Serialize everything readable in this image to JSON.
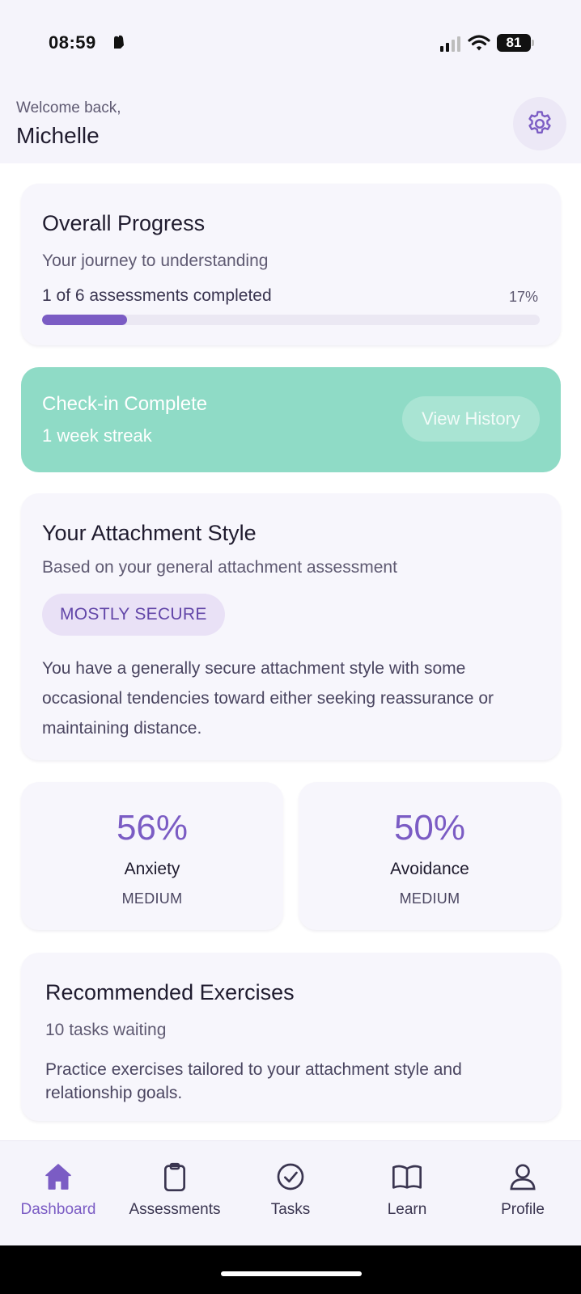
{
  "status_bar": {
    "time": "08:59",
    "battery": "81"
  },
  "header": {
    "welcome": "Welcome back,",
    "user_name": "Michelle"
  },
  "progress": {
    "title": "Overall Progress",
    "subtitle": "Your journey to understanding",
    "summary": "1 of 6 assessments completed",
    "percent_label": "17%",
    "fraction": 0.17
  },
  "checkin": {
    "title": "Check-in Complete",
    "streak": "1 week streak",
    "history_button": "View History"
  },
  "attachment": {
    "title": "Your Attachment Style",
    "subtitle": "Based on your general attachment assessment",
    "badge": "MOSTLY SECURE",
    "description": "You have a generally secure attachment style with some occasional tendencies toward either seeking reassurance or maintaining distance."
  },
  "metrics": [
    {
      "value": "56%",
      "label": "Anxiety",
      "level": "MEDIUM"
    },
    {
      "value": "50%",
      "label": "Avoidance",
      "level": "MEDIUM"
    }
  ],
  "exercises": {
    "title": "Recommended Exercises",
    "subtitle": "10 tasks waiting",
    "description": "Practice exercises tailored to your attachment style and relationship goals."
  },
  "nav": [
    {
      "label": "Dashboard",
      "icon": "home-icon",
      "active": true
    },
    {
      "label": "Assessments",
      "icon": "clipboard-icon",
      "active": false
    },
    {
      "label": "Tasks",
      "icon": "check-circle-icon",
      "active": false
    },
    {
      "label": "Learn",
      "icon": "book-icon",
      "active": false
    },
    {
      "label": "Profile",
      "icon": "user-icon",
      "active": false
    }
  ],
  "colors": {
    "accent": "#7b5cc4",
    "checkin_green": "#8fdbc6",
    "card_bg": "#f7f6fc",
    "badge_bg": "#e9e1f6"
  }
}
